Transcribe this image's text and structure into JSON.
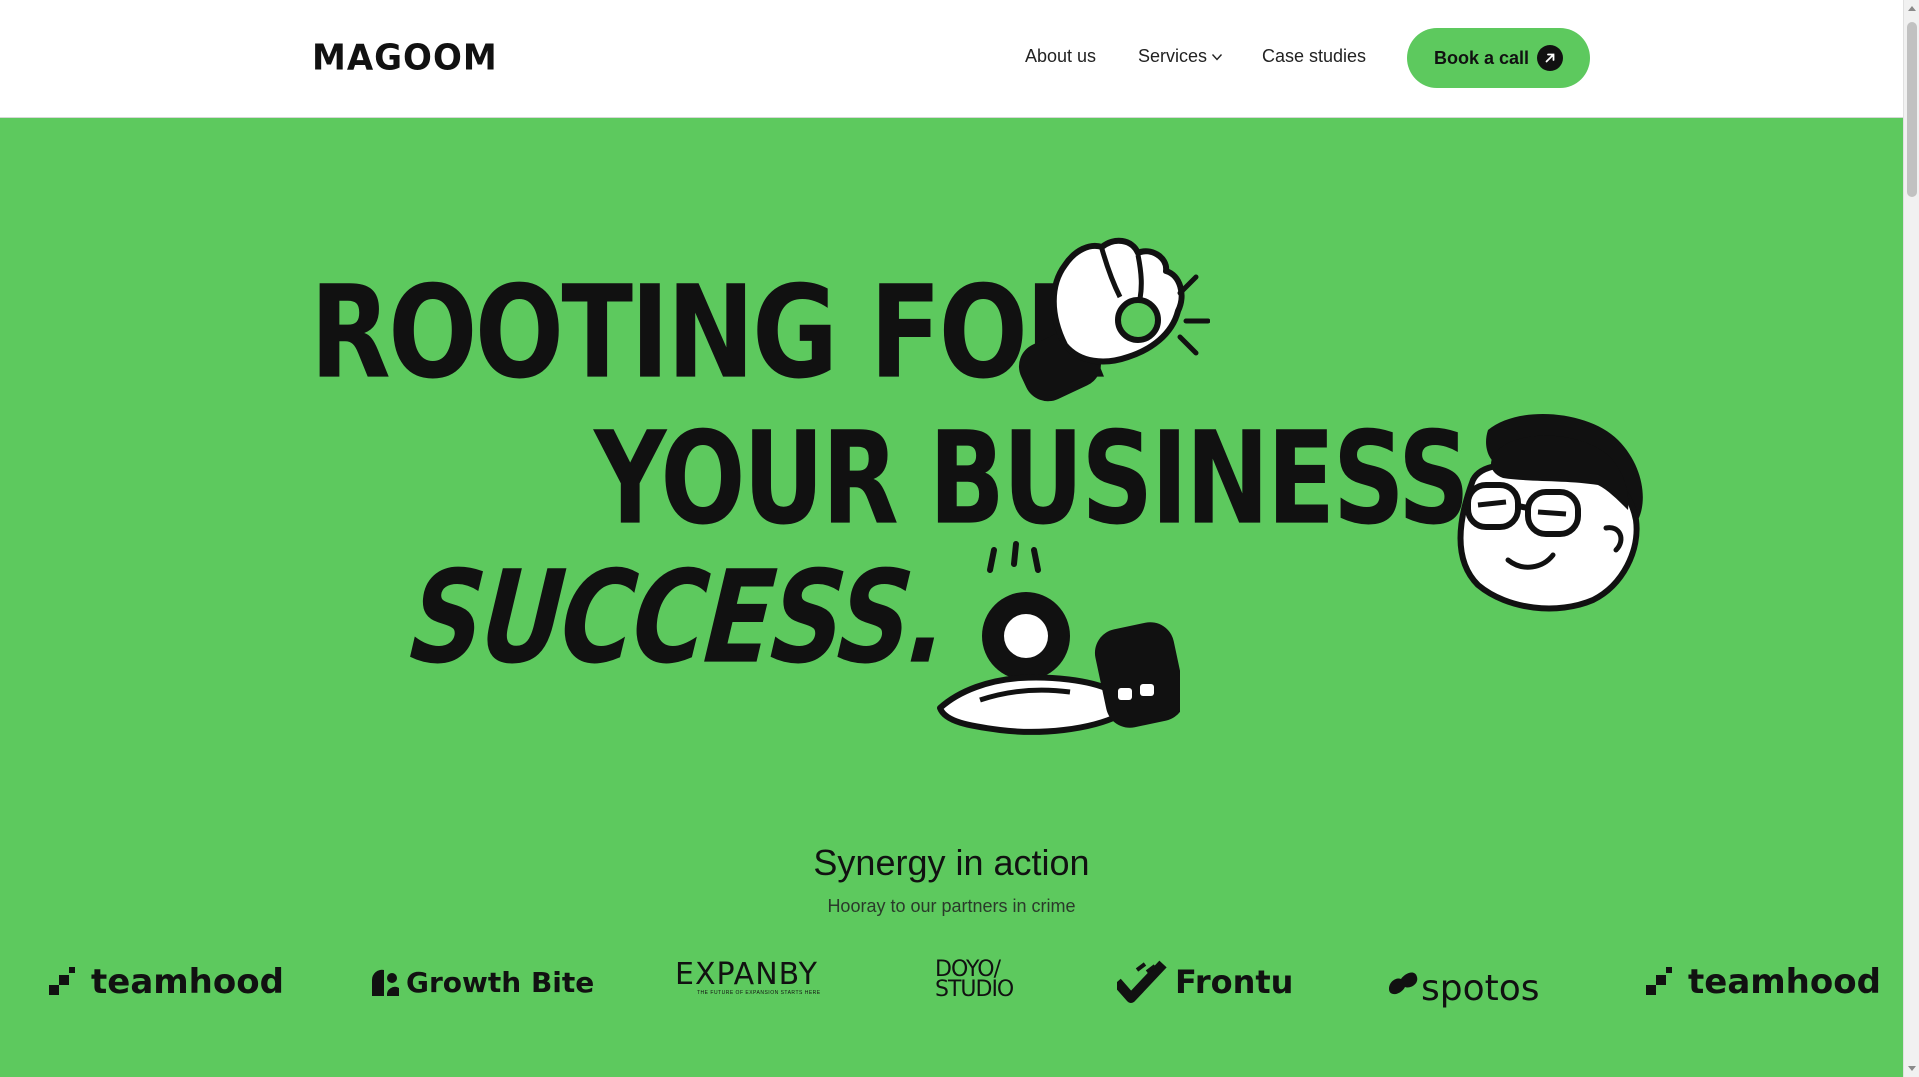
{
  "header": {
    "logo": "MAGOOM",
    "nav": [
      {
        "label": "About us"
      },
      {
        "label": "Services"
      },
      {
        "label": "Case studies"
      }
    ],
    "cta_label": "Book a call"
  },
  "hero": {
    "line1": "ROOTING FOR",
    "line2": "YOUR BUSINESS",
    "line3": "SUCCESS."
  },
  "synergy": {
    "title": "Synergy in action",
    "subtitle": "Hooray to our partners in crime"
  },
  "partners": [
    {
      "name": "teamhood",
      "icon": "teamhood-logo-icon"
    },
    {
      "name": "Growth Bite",
      "icon": "growthbite-logo-icon"
    },
    {
      "name": "EXPANBY",
      "tagline": "THE FUTURE OF EXPANSION STARTS HERE",
      "icon": "expanby-logo-icon"
    },
    {
      "name_top": "DOYO/",
      "name_bottom": "STUDIO",
      "icon": "doyo-studio-logo"
    },
    {
      "name": "Frontu",
      "icon": "frontu-logo-icon"
    },
    {
      "name": "spotos",
      "icon": "spotos-logo-icon"
    },
    {
      "name": "teamhood",
      "icon": "teamhood-logo-icon"
    }
  ],
  "colors": {
    "brand_green": "#5dc95e",
    "ink": "#111111",
    "header_bg": "#ffffff"
  }
}
